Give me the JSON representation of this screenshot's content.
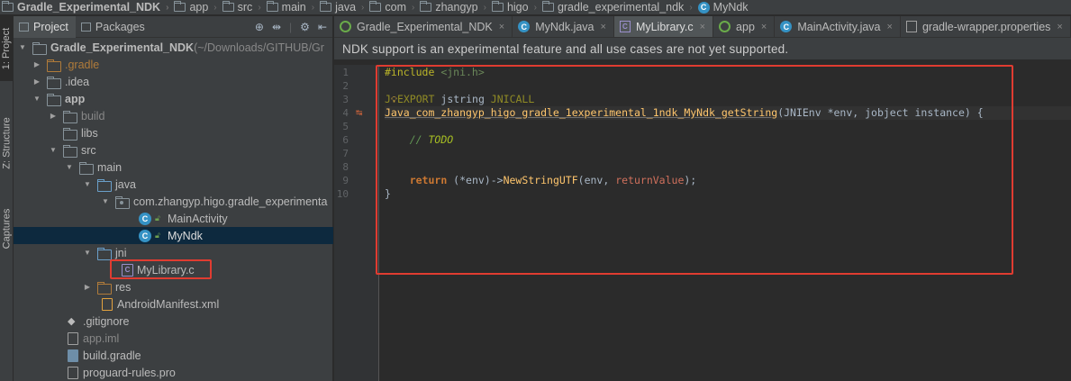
{
  "breadcrumb": [
    {
      "label": "Gradle_Experimental_NDK",
      "icon": "folder-icon"
    },
    {
      "label": "app",
      "icon": "folder-icon"
    },
    {
      "label": "src",
      "icon": "folder-icon"
    },
    {
      "label": "main",
      "icon": "folder-icon"
    },
    {
      "label": "java",
      "icon": "folder-icon"
    },
    {
      "label": "com",
      "icon": "package-icon"
    },
    {
      "label": "zhangyp",
      "icon": "package-icon"
    },
    {
      "label": "higo",
      "icon": "package-icon"
    },
    {
      "label": "gradle_experimental_ndk",
      "icon": "package-icon"
    },
    {
      "label": "MyNdk",
      "icon": "class-icon"
    }
  ],
  "stripe": {
    "project": "1: Project",
    "structure": "Z: Structure",
    "captures": "Captures"
  },
  "project_panel": {
    "tabs": [
      "Project",
      "Packages"
    ],
    "tree": [
      {
        "label": "Gradle_Experimental_NDK",
        "suffix": " (~/Downloads/GITHUB/Gr"
      },
      {
        "label": ".gradle"
      },
      {
        "label": ".idea"
      },
      {
        "label": "app"
      },
      {
        "label": "build"
      },
      {
        "label": "libs"
      },
      {
        "label": "src"
      },
      {
        "label": "main"
      },
      {
        "label": "java"
      },
      {
        "label": "com.zhangyp.higo.gradle_experimenta"
      },
      {
        "label": "MainActivity"
      },
      {
        "label": "MyNdk"
      },
      {
        "label": "jni"
      },
      {
        "label": "MyLibrary.c"
      },
      {
        "label": "res"
      },
      {
        "label": "AndroidManifest.xml"
      },
      {
        "label": ".gitignore"
      },
      {
        "label": "app.iml"
      },
      {
        "label": "build.gradle"
      },
      {
        "label": "proguard-rules.pro"
      }
    ]
  },
  "editor": {
    "tabs": [
      {
        "label": "Gradle_Experimental_NDK",
        "icon": "gradle-icon"
      },
      {
        "label": "MyNdk.java",
        "icon": "class-icon"
      },
      {
        "label": "MyLibrary.c",
        "icon": "c-file-icon"
      },
      {
        "label": "app",
        "icon": "gradle-icon"
      },
      {
        "label": "MainActivity.java",
        "icon": "class-icon"
      },
      {
        "label": "gradle-wrapper.properties",
        "icon": "properties-icon"
      }
    ],
    "notice": "NDK support is an experimental feature and all use cases are not yet supported.",
    "line_numbers": [
      "1",
      "2",
      "3",
      "4",
      "5",
      "6",
      "7",
      "8",
      "9",
      "10"
    ],
    "code": {
      "l1_directive": "#include",
      "l1_header": " <jni.h>",
      "l3_a": "J",
      "l3_b": "EXPORT",
      "l3_c": " jstring ",
      "l3_d": "JNICALL",
      "l4_fn": "Java_com_zhangyp_higo_gradle_1experimental_1ndk_MyNdk_getString",
      "l4_rest": "(JNIEnv *env, jobject instance) {",
      "l6_cmt": "// ",
      "l6_todo": "TODO",
      "l9_kw": "return",
      "l9_a": " (*env)->",
      "l9_call": "NewStringUTF",
      "l9_b": "(env, ",
      "l9_var": "returnValue",
      "l9_c": ");",
      "l10": "}"
    }
  },
  "colors": {
    "highlight_box": "#e03c31",
    "selection": "#0d293e",
    "keyword": "#cc7832",
    "function": "#ffc66d"
  }
}
